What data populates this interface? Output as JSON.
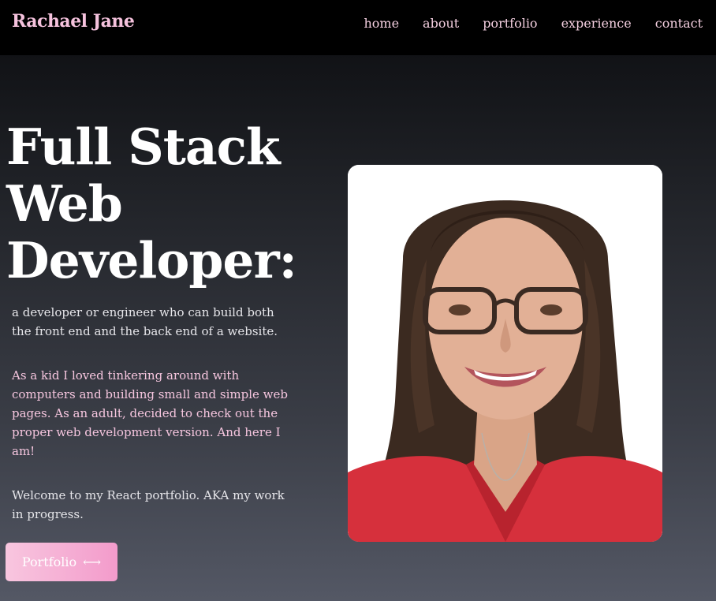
{
  "navbar": {
    "brand": "Rachael Jane",
    "links": [
      "home",
      "about",
      "portfolio",
      "experience",
      "contact"
    ]
  },
  "hero": {
    "title_lines": [
      "Full Stack",
      "Web",
      "Developer:"
    ],
    "definition": "a developer or engineer who can build both the front end and the back end of a website.",
    "story": "As a kid I loved tinkering around with computers and building small and simple web pages. As an adult, decided to check out the proper web development version. And here I am!",
    "welcome": "Welcome to my React portfolio. AKA my work in progress.",
    "button_label": "Portfolio",
    "button_icon": "double-arrow-icon"
  },
  "colors": {
    "accent_pink": "#f5c2dd",
    "button_gradient_start": "#f8c6df",
    "button_gradient_end": "#f39bcb",
    "navbar_bg": "#000000",
    "bg_top": "#0b0c0f",
    "bg_bottom": "#545865"
  }
}
